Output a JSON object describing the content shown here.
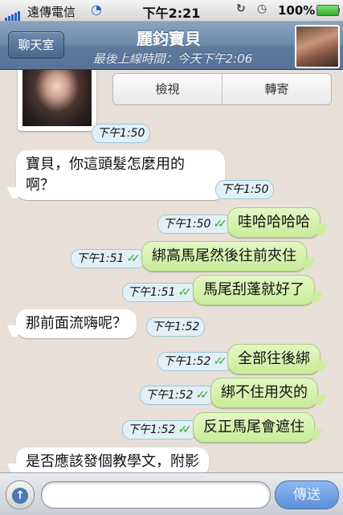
{
  "status_bar": {
    "carrier": "遠傳電信",
    "time": "下午2:21",
    "battery": "100%",
    "battery_level": 1.0
  },
  "nav": {
    "back_label": "聊天室",
    "title": "麗鈞寶貝",
    "subtitle": "最後上線時間：今天下午2:06"
  },
  "actions": {
    "view_label": "檢視",
    "forward_label": "轉寄"
  },
  "messages": [
    {
      "dir": "in",
      "type": "photo",
      "time": "下午1:50"
    },
    {
      "dir": "in",
      "lines": [
        "寶貝，你這頭髮怎麼用的",
        "啊？"
      ],
      "time": "下午1:50"
    },
    {
      "dir": "out",
      "text": "哇哈哈哈哈",
      "time": "下午1:50",
      "read": true
    },
    {
      "dir": "out",
      "text": "綁高馬尾然後往前夾住",
      "time": "下午1:51",
      "read": true
    },
    {
      "dir": "out",
      "text": "馬尾刮蓬就好了",
      "time": "下午1:51",
      "read": true
    },
    {
      "dir": "in",
      "text": "那前面流嗨呢？",
      "time": "下午1:52"
    },
    {
      "dir": "out",
      "text": "全部往後綁",
      "time": "下午1:52",
      "read": true
    },
    {
      "dir": "out",
      "text": "綁不住用夾的",
      "time": "下午1:52",
      "read": true
    },
    {
      "dir": "out",
      "text": "反正馬尾會遮住",
      "time": "下午1:52",
      "read": true
    },
    {
      "dir": "in",
      "text": "是否應該發個教學文，附影",
      "time": ""
    }
  ],
  "input": {
    "placeholder": "",
    "send_label": "傳送"
  },
  "colors": {
    "nav_bar": "#6d89aa",
    "chat_background": "#e8dfd8",
    "outgoing_bubble": "#d6f1b0",
    "incoming_bubble": "#ffffff",
    "read_check": "#3aa22a",
    "send_button": "#6f9ee2"
  },
  "icons": {
    "signal": "signal-bars-icon",
    "wifi": "wifi-icon",
    "orientation_lock": "orientation-lock-icon",
    "alarm": "alarm-icon",
    "battery": "battery-icon",
    "attach": "up-arrow-icon",
    "read": "double-check-icon"
  }
}
